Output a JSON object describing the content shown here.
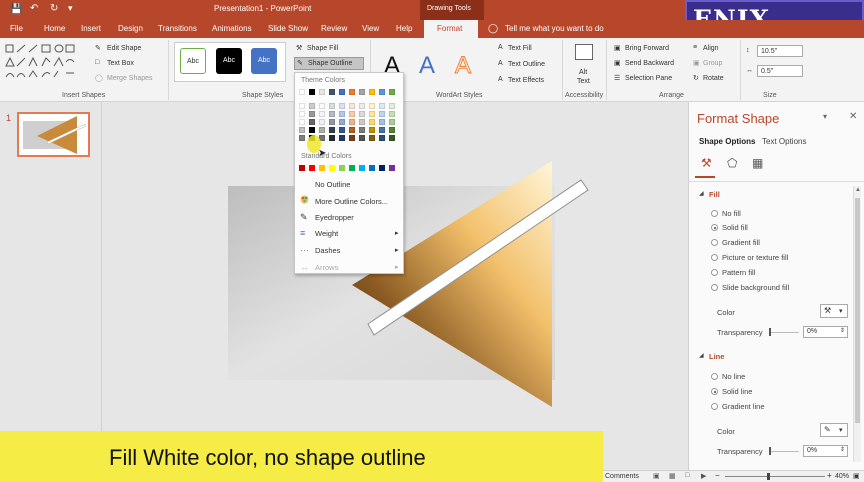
{
  "titlebar": {
    "title": "Presentation1 - PowerPoint",
    "context": "Drawing Tools"
  },
  "tabs": [
    "File",
    "Home",
    "Insert",
    "Design",
    "Transitions",
    "Animations",
    "Slide Show",
    "Review",
    "View",
    "Help",
    "Format"
  ],
  "tell_me": "Tell me what you want to do",
  "logo": "ENIX Tutorials",
  "ribbon": {
    "insert_shapes": {
      "edit_shape": "Edit Shape",
      "text_box": "Text Box",
      "merge_shapes": "Merge Shapes",
      "label": "Insert Shapes"
    },
    "shape_styles": {
      "style_sample": "Abc",
      "shape_fill": "Shape Fill",
      "shape_outline": "Shape Outline",
      "label": "Shape Styles"
    },
    "wordart": {
      "letter": "A",
      "text_fill": "Text Fill",
      "text_outline": "Text Outline",
      "text_effects": "Text Effects",
      "label": "WordArt Styles"
    },
    "accessibility": {
      "alt_text_1": "Alt",
      "alt_text_2": "Text",
      "label": "Accessibility"
    },
    "arrange": {
      "bring_forward": "Bring Forward",
      "send_backward": "Send Backward",
      "selection_pane": "Selection Pane",
      "align": "Align",
      "group": "Group",
      "rotate": "Rotate",
      "label": "Arrange"
    },
    "size": {
      "height": "10.5\"",
      "width": "0.5\"",
      "label": "Size"
    }
  },
  "thumbnail_number": "1",
  "menu": {
    "theme_colors": "Theme Colors",
    "standard_colors": "Standard Colors",
    "no_outline": "No Outline",
    "more_outline_colors": "More Outline Colors...",
    "eyedropper": "Eyedropper",
    "weight": "Weight",
    "dashes": "Dashes",
    "arrows": "Arrows",
    "theme_top": [
      "#ffffff",
      "#000000",
      "#e7e6e6",
      "#44546a",
      "#4472c4",
      "#ed7d31",
      "#a5a5a5",
      "#ffc000",
      "#5b9bd5",
      "#70ad47"
    ],
    "standard": [
      "#c00000",
      "#ff0000",
      "#ffc000",
      "#ffff00",
      "#92d050",
      "#00b050",
      "#00b0f0",
      "#0070c0",
      "#002060",
      "#7030a0"
    ]
  },
  "format_pane": {
    "title": "Format Shape",
    "tab_shape": "Shape Options",
    "tab_text": "Text Options",
    "fill_header": "Fill",
    "fill_options": [
      "No fill",
      "Solid fill",
      "Gradient fill",
      "Picture or texture fill",
      "Pattern fill",
      "Slide background fill"
    ],
    "color_label": "Color",
    "transparency_label": "Transparency",
    "transparency_value": "0%",
    "line_header": "Line",
    "line_options": [
      "No line",
      "Solid line",
      "Gradient line"
    ]
  },
  "caption": "Fill White color, no shape outline",
  "status": {
    "comments": "Comments",
    "zoom": "40%"
  }
}
